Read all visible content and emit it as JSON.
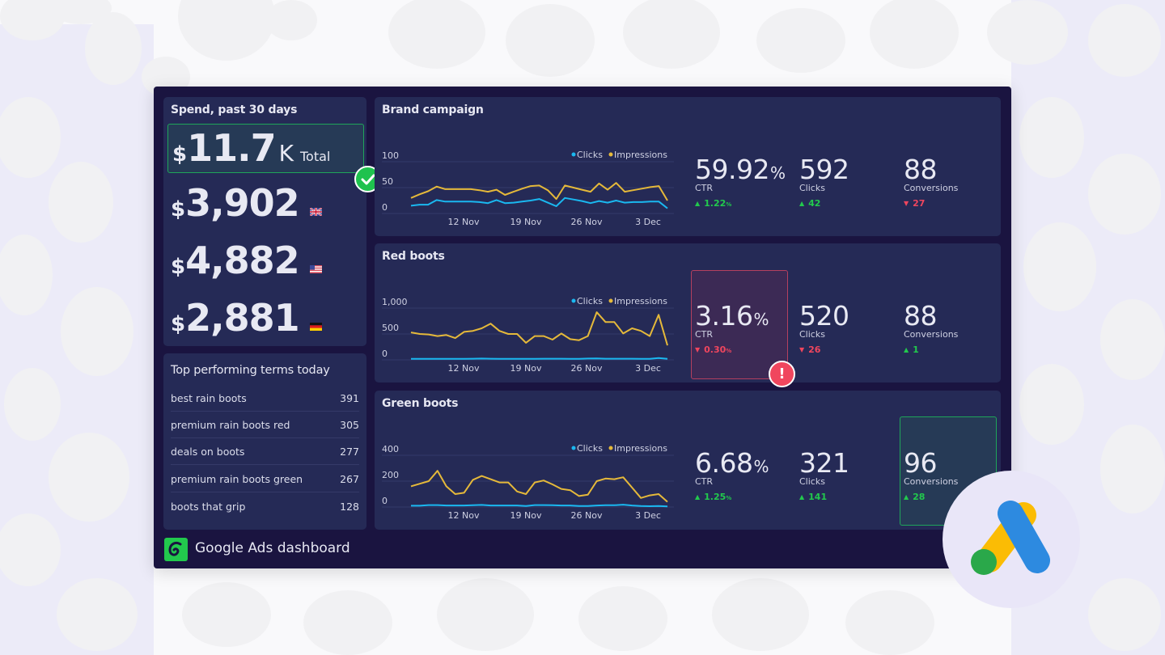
{
  "colors": {
    "clicks": "#1ab8f0",
    "impressions": "#e5b93a",
    "up": "#22c94d",
    "down": "#f0465e",
    "panel": "#252a56",
    "dashboard_bg": "#1a1440"
  },
  "footer": {
    "title": "Google Ads dashboard",
    "logo_icon": "brand-logo-icon"
  },
  "spend": {
    "title": "Spend, past 30 days",
    "total": {
      "currency": "$",
      "value": "11.7",
      "unit": "K",
      "label": "Total",
      "status_icon": "check-icon"
    },
    "countries": [
      {
        "currency": "$",
        "value": "3,902",
        "flag": "uk-flag-icon"
      },
      {
        "currency": "$",
        "value": "4,882",
        "flag": "us-flag-icon"
      },
      {
        "currency": "$",
        "value": "2,881",
        "flag": "germany-flag-icon"
      }
    ]
  },
  "terms": {
    "title": "Top performing terms today",
    "rows": [
      {
        "term": "best rain boots",
        "count": "391"
      },
      {
        "term": "premium rain boots red",
        "count": "305"
      },
      {
        "term": "deals on boots",
        "count": "277"
      },
      {
        "term": "premium rain boots green",
        "count": "267"
      },
      {
        "term": "boots that grip",
        "count": "128"
      }
    ]
  },
  "campaigns": [
    {
      "title": "Brand campaign",
      "metrics": [
        {
          "value": "59.92",
          "suffix": "%",
          "name": "CTR",
          "delta": "1.22",
          "delta_suffix": "%",
          "direction": "up"
        },
        {
          "value": "592",
          "suffix": "",
          "name": "Clicks",
          "delta": "42",
          "delta_suffix": "",
          "direction": "up"
        },
        {
          "value": "88",
          "suffix": "",
          "name": "Conversions",
          "delta": "27",
          "delta_suffix": "",
          "direction": "down"
        }
      ]
    },
    {
      "title": "Red boots",
      "alert": "!",
      "metrics": [
        {
          "value": "3.16",
          "suffix": "%",
          "name": "CTR",
          "delta": "0.30",
          "delta_suffix": "%",
          "direction": "down"
        },
        {
          "value": "520",
          "suffix": "",
          "name": "Clicks",
          "delta": "26",
          "delta_suffix": "",
          "direction": "down"
        },
        {
          "value": "88",
          "suffix": "",
          "name": "Conversions",
          "delta": "1",
          "delta_suffix": "",
          "direction": "up"
        }
      ]
    },
    {
      "title": "Green boots",
      "metrics": [
        {
          "value": "6.68",
          "suffix": "%",
          "name": "CTR",
          "delta": "1.25",
          "delta_suffix": "%",
          "direction": "up"
        },
        {
          "value": "321",
          "suffix": "",
          "name": "Clicks",
          "delta": "141",
          "delta_suffix": "",
          "direction": "up"
        },
        {
          "value": "96",
          "suffix": "",
          "name": "Conversions",
          "delta": "28",
          "delta_suffix": "",
          "direction": "up"
        }
      ]
    }
  ],
  "chart_data": [
    {
      "type": "line",
      "title": "Brand campaign",
      "legend": [
        "Clicks",
        "Impressions"
      ],
      "legend_position": "top-right",
      "x_ticks": [
        "12 Nov",
        "19 Nov",
        "26 Nov",
        "3 Dec"
      ],
      "y_ticks": [
        "0",
        "50",
        "100"
      ],
      "ylim": [
        0,
        100
      ],
      "grid": true,
      "series": [
        {
          "name": "Impressions",
          "values": [
            30,
            37,
            43,
            52,
            47,
            47,
            47,
            47,
            45,
            42,
            46,
            36,
            42,
            48,
            53,
            54,
            45,
            28,
            54,
            50,
            46,
            42,
            58,
            46,
            59,
            42,
            45,
            48,
            51,
            53,
            25
          ]
        },
        {
          "name": "Clicks",
          "values": [
            15,
            17,
            17,
            26,
            23,
            23,
            23,
            23,
            22,
            20,
            26,
            20,
            21,
            23,
            25,
            28,
            21,
            14,
            30,
            27,
            24,
            20,
            24,
            21,
            25,
            21,
            22,
            22,
            23,
            23,
            10
          ]
        }
      ]
    },
    {
      "type": "line",
      "title": "Red boots",
      "legend": [
        "Clicks",
        "Impressions"
      ],
      "legend_position": "top-right",
      "x_ticks": [
        "12 Nov",
        "19 Nov",
        "26 Nov",
        "3 Dec"
      ],
      "y_ticks": [
        "0",
        "500",
        "1,000"
      ],
      "ylim": [
        0,
        1000
      ],
      "grid": true,
      "series": [
        {
          "name": "Impressions",
          "values": [
            530,
            500,
            490,
            460,
            480,
            420,
            540,
            560,
            610,
            700,
            560,
            500,
            500,
            330,
            460,
            460,
            390,
            510,
            400,
            380,
            460,
            920,
            730,
            730,
            510,
            610,
            560,
            460,
            870,
            280
          ]
        },
        {
          "name": "Clicks",
          "values": [
            20,
            20,
            20,
            20,
            20,
            20,
            20,
            22,
            25,
            22,
            20,
            20,
            20,
            20,
            20,
            22,
            22,
            22,
            20,
            20,
            25,
            28,
            22,
            22,
            22,
            22,
            20,
            20,
            35,
            20
          ]
        }
      ]
    },
    {
      "type": "line",
      "title": "Green boots",
      "legend": [
        "Clicks",
        "Impressions"
      ],
      "legend_position": "top-right",
      "x_ticks": [
        "12 Nov",
        "19 Nov",
        "26 Nov",
        "3 Dec"
      ],
      "y_ticks": [
        "0",
        "200",
        "400"
      ],
      "ylim": [
        0,
        400
      ],
      "grid": true,
      "series": [
        {
          "name": "Impressions",
          "values": [
            160,
            180,
            200,
            280,
            160,
            100,
            110,
            210,
            240,
            215,
            190,
            190,
            120,
            100,
            190,
            205,
            175,
            140,
            130,
            85,
            95,
            200,
            220,
            215,
            230,
            150,
            70,
            90,
            100,
            40
          ]
        },
        {
          "name": "Clicks",
          "values": [
            10,
            10,
            15,
            15,
            12,
            12,
            12,
            14,
            16,
            12,
            12,
            12,
            12,
            8,
            15,
            15,
            14,
            12,
            12,
            8,
            8,
            12,
            14,
            14,
            18,
            12,
            8,
            6,
            8,
            5
          ]
        }
      ]
    }
  ]
}
